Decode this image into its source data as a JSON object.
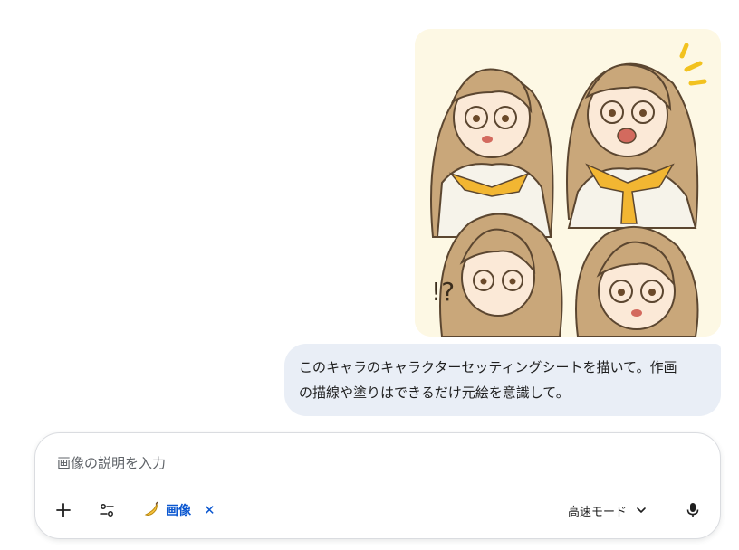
{
  "message": {
    "lines": [
      "このキャラのキャラクターセッティングシートを描いて。作画",
      "の描線や塗りはできるだけ元絵を意識して。"
    ]
  },
  "composer": {
    "placeholder": "画像の説明を入力",
    "value": "",
    "add_icon": "plus-icon",
    "tools_icon": "tune-icon",
    "chip": {
      "icon": "banana-icon",
      "label": "画像",
      "remove_label": "✕"
    },
    "mode": {
      "label": "高速モード",
      "icon": "chevron-down-icon"
    },
    "mic_icon": "mic-icon"
  },
  "image": {
    "subject": "anime-character-sheet"
  },
  "colors": {
    "bubble_bg": "#e9eef6",
    "accent_blue": "#0b57d0",
    "hair": "#c9a77a",
    "scarf": "#f2b632"
  }
}
